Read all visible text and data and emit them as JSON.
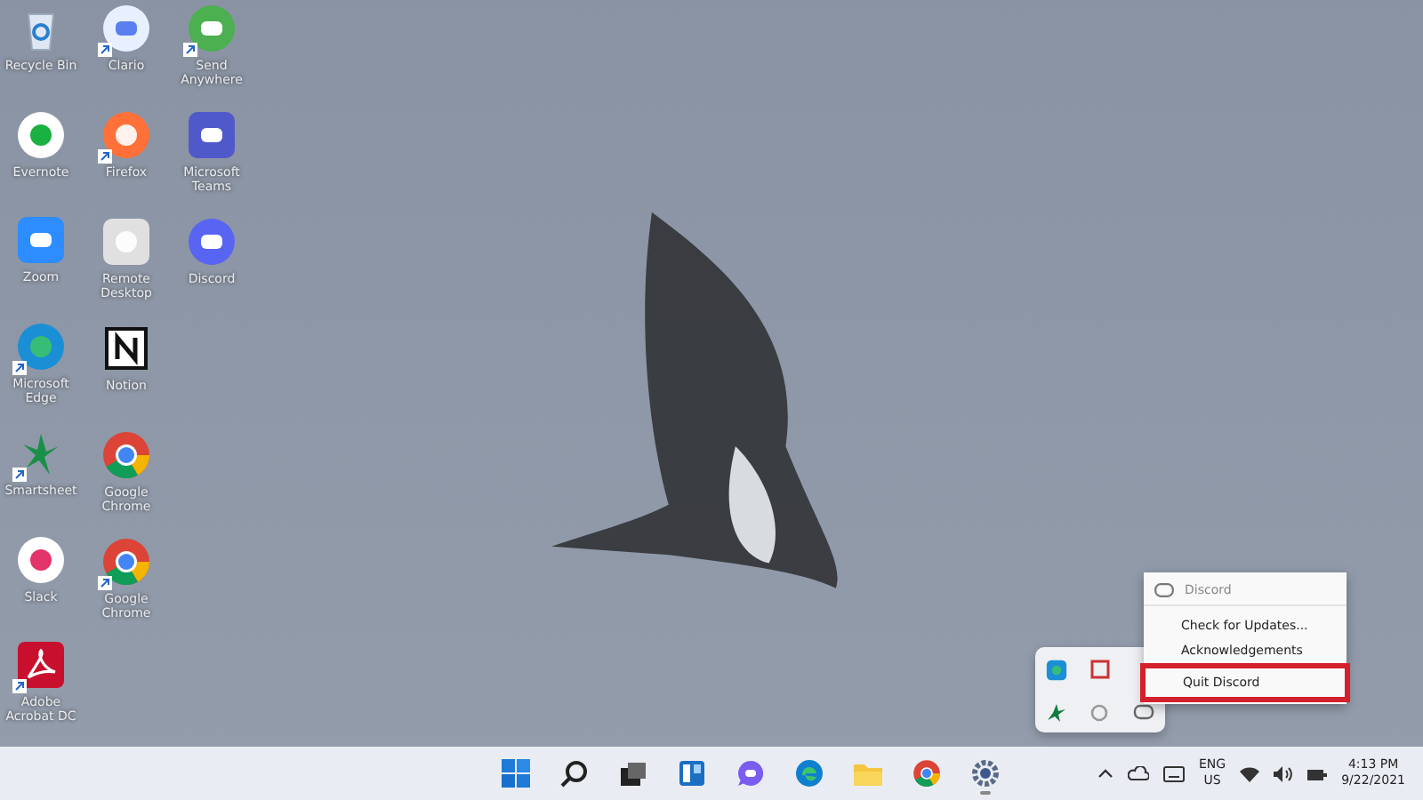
{
  "desktop": {
    "columns": [
      [
        {
          "label": "Recycle Bin",
          "kind": "recycle",
          "shortcut": false
        },
        {
          "label": "Evernote",
          "kind": "evernote",
          "shortcut": false
        },
        {
          "label": "Zoom",
          "kind": "zoom",
          "shortcut": false
        },
        {
          "label": "Microsoft Edge",
          "kind": "edge",
          "shortcut": true
        },
        {
          "label": "Smartsheet",
          "kind": "smartsheet",
          "shortcut": true
        },
        {
          "label": "Slack",
          "kind": "slack",
          "shortcut": false
        },
        {
          "label": "Adobe Acrobat DC",
          "kind": "acrobat",
          "shortcut": true
        }
      ],
      [
        {
          "label": "Clario",
          "kind": "heart",
          "shortcut": true
        },
        {
          "label": "Firefox",
          "kind": "firefox",
          "shortcut": true
        },
        {
          "label": "Remote Desktop",
          "kind": "remote",
          "shortcut": false
        },
        {
          "label": "Notion",
          "kind": "notion",
          "shortcut": false
        },
        {
          "label": "Google Chrome",
          "kind": "chrome",
          "shortcut": false
        },
        {
          "label": "Google Chrome",
          "kind": "chrome",
          "shortcut": true
        }
      ],
      [
        {
          "label": "Send Anywhere",
          "kind": "send",
          "shortcut": true
        },
        {
          "label": "Microsoft Teams",
          "kind": "teams",
          "shortcut": false
        },
        {
          "label": "Discord",
          "kind": "discord",
          "shortcut": false
        }
      ]
    ]
  },
  "tray_overflow": [
    {
      "kind": "edge"
    },
    {
      "kind": "snip"
    },
    {
      "kind": "blank"
    },
    {
      "kind": "smartsheet"
    },
    {
      "kind": "gear"
    },
    {
      "kind": "discord"
    }
  ],
  "context_menu": {
    "header": "Discord",
    "items": [
      {
        "label": "Check for Updates...",
        "highlighted": false
      },
      {
        "label": "Acknowledgements",
        "highlighted": false
      },
      {
        "label": "Quit Discord",
        "highlighted": true
      }
    ]
  },
  "taskbar": {
    "apps": [
      {
        "kind": "start"
      },
      {
        "kind": "search"
      },
      {
        "kind": "taskview"
      },
      {
        "kind": "widgets"
      },
      {
        "kind": "chat"
      },
      {
        "kind": "edge"
      },
      {
        "kind": "explorer"
      },
      {
        "kind": "chrome"
      },
      {
        "kind": "settings",
        "running": true
      }
    ],
    "language": "ENG",
    "region": "US",
    "time": "4:13 PM",
    "date": "9/22/2021"
  }
}
